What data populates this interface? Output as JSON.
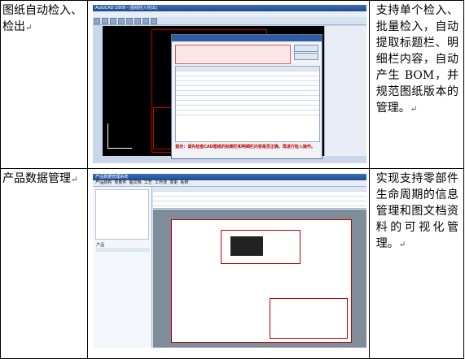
{
  "rows": [
    {
      "label": "图纸自动检入、检出",
      "description": "支持单个检入、批量检入，自动提取标题栏、明细栏内容，自动产生 BOM，并规范图纸版本的管理。",
      "screenshot": {
        "window_title": "AutoCAD 2008 - [图纸检入检出]",
        "dialog_note": "提示：请先检查CAD图纸的标题栏和明细栏内容是否正确，再进行检入操作。"
      }
    },
    {
      "label": "产品数据管理",
      "description": "实现支持零部件生命周期的信息管理和图文档资料的可视化管理。",
      "screenshot": {
        "window_title": "产品数据管理系统",
        "tabs": [
          "产品结构",
          "零部件",
          "图文档",
          "工艺",
          "工作流",
          "变更",
          "系统"
        ],
        "tree_root": "产品"
      }
    }
  ],
  "paragraph_mark": "↵"
}
